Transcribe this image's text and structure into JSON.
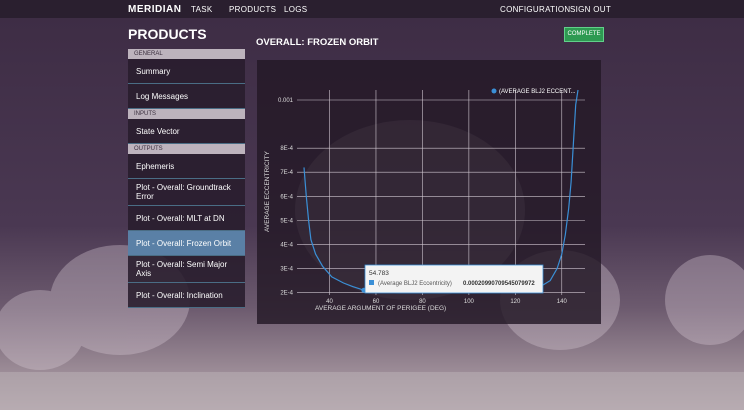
{
  "topnav": {
    "brand": "MERIDIAN",
    "links": [
      "TASK",
      "PRODUCTS",
      "LOGS"
    ],
    "right_links": [
      "CONFIGURATION",
      "SIGN OUT"
    ]
  },
  "page_title": "PRODUCTS",
  "sidebar": {
    "general_header": "GENERAL",
    "general_items": [
      "Summary",
      "Log Messages"
    ],
    "inputs_header": "INPUTS",
    "inputs_items": [
      "State Vector"
    ],
    "outputs_header": "OUTPUTS",
    "outputs_items": [
      "Ephemeris",
      "Plot - Overall: Groundtrack Error",
      "Plot - Overall: MLT at DN",
      "Plot - Overall: Frozen Orbit",
      "Plot - Overall: Semi Major Axis",
      "Plot - Overall: Inclination"
    ],
    "active_item": "Plot - Overall: Frozen Orbit"
  },
  "complete_button": "COMPLETE",
  "chart_title": "OVERALL: FROZEN ORBIT",
  "tooltip": {
    "x_value": "54.783",
    "series_label": "(Average BLJ2 Eccentricity)",
    "y_value": "0.00020990709545079972"
  },
  "colors": {
    "series": "#3a8fd6",
    "active_item": "#5a80a6",
    "complete": "#2e9a52"
  },
  "chart_data": {
    "type": "line",
    "xlabel": "AVERAGE ARGUMENT OF PERIGEE (DEG)",
    "ylabel": "AVERAGE ECCENTRICITY",
    "x_ticks": [
      40,
      60,
      80,
      100,
      120,
      140
    ],
    "y_tick_labels": [
      "2E-4",
      "3E-4",
      "4E-4",
      "5E-4",
      "6E-4",
      "7E-4",
      "8E-4",
      "0.001"
    ],
    "xlim": [
      26,
      150
    ],
    "ylim": [
      0.00019,
      0.001
    ],
    "legend": "top-right",
    "series": [
      {
        "name": "(AVERAGE BLJ2 ECCENT...",
        "points": [
          [
            29,
            0.00072
          ],
          [
            30,
            0.0006
          ],
          [
            31,
            0.0005
          ],
          [
            32,
            0.00042
          ],
          [
            34,
            0.00036
          ],
          [
            37,
            0.00031
          ],
          [
            41,
            0.000265
          ],
          [
            46,
            0.00024
          ],
          [
            50,
            0.000225
          ],
          [
            54.783,
            0.00020990709545079972
          ],
          [
            60,
            0.000205
          ],
          [
            70,
            0.0002
          ],
          [
            80,
            0.0002
          ],
          [
            90,
            0.0002
          ],
          [
            100,
            0.0002
          ],
          [
            110,
            0.000202
          ],
          [
            120,
            0.000208
          ],
          [
            130,
            0.00022
          ],
          [
            135,
            0.00025
          ],
          [
            138,
            0.0003
          ],
          [
            140,
            0.00036
          ],
          [
            141.5,
            0.00044
          ],
          [
            143,
            0.00055
          ],
          [
            144,
            0.00066
          ],
          [
            145,
            0.00082
          ],
          [
            146,
            0.00098
          ],
          [
            147,
            0.00108
          ]
        ]
      }
    ]
  }
}
